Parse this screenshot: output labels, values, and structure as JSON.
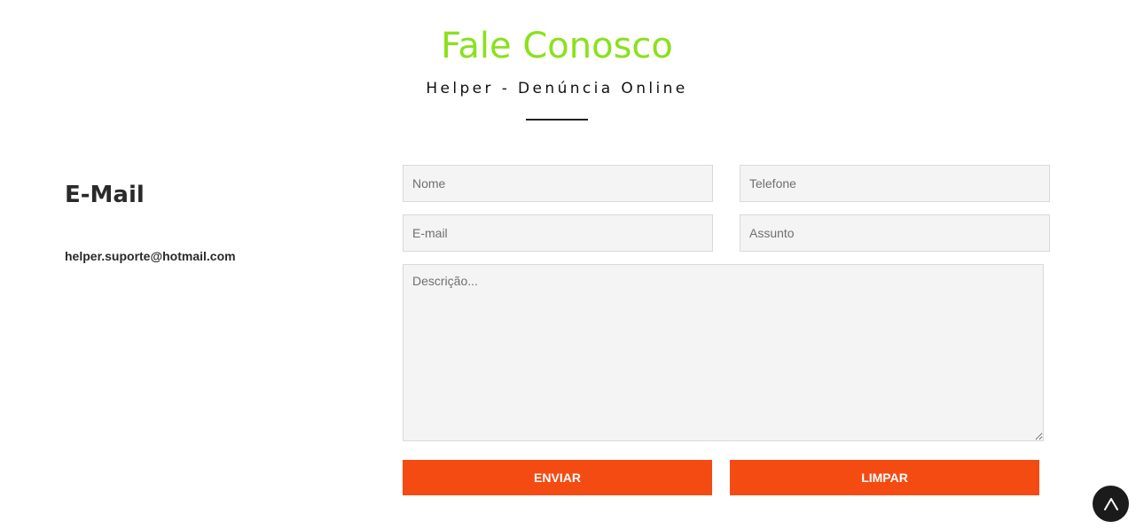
{
  "header": {
    "title": "Fale Conosco",
    "subtitle": "Helper - Denúncia Online"
  },
  "contact": {
    "heading": "E-Mail",
    "email": "helper.suporte@hotmail.com"
  },
  "form": {
    "nome_placeholder": "Nome",
    "telefone_placeholder": "Telefone",
    "email_placeholder": "E-mail",
    "assunto_placeholder": "Assunto",
    "descricao_placeholder": "Descrição...",
    "submit_label": "ENVIAR",
    "reset_label": "LIMPAR"
  },
  "scroll_top": {
    "icon": "chevron-up-icon"
  },
  "colors": {
    "title": "#8ae11b",
    "button": "#f44b12",
    "scroll_button": "#1b1b1b"
  }
}
